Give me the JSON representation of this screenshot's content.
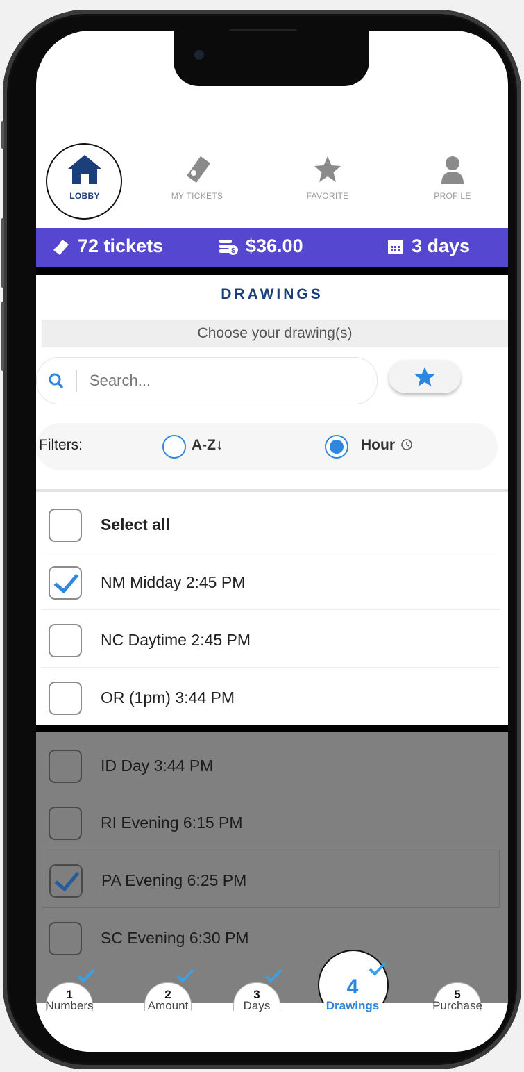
{
  "nav": {
    "items": [
      {
        "label": "LOBBY",
        "icon": "home-icon",
        "active": true
      },
      {
        "label": "MY TICKETS",
        "icon": "ticket-icon",
        "active": false
      },
      {
        "label": "FAVORITE",
        "icon": "star-icon",
        "active": false
      },
      {
        "label": "PROFILE",
        "icon": "user-icon",
        "active": false
      }
    ]
  },
  "stats": {
    "tickets": "72 tickets",
    "amount": "$36.00",
    "days": "3 days",
    "bar_color": "#5547cf"
  },
  "drawings": {
    "title": "DRAWINGS",
    "subtitle": "Choose your drawing(s)",
    "search_placeholder": "Search...",
    "filters_label": "Filters:",
    "filter_az": "A-Z↓",
    "filter_hour": "Hour",
    "selected_filter": "Hour"
  },
  "list": {
    "select_all": "Select all",
    "items": [
      {
        "label": "NM Midday 2:45 PM",
        "checked": true
      },
      {
        "label": "NC Daytime 2:45 PM",
        "checked": false
      },
      {
        "label": "OR (1pm) 3:44 PM",
        "checked": false
      }
    ],
    "overlay_items": [
      {
        "label": "ID Day 3:44 PM",
        "checked": false
      },
      {
        "label": "RI Evening 6:15 PM",
        "checked": false
      },
      {
        "label": "PA Evening 6:25 PM",
        "checked": true
      },
      {
        "label": "SC Evening 6:30 PM",
        "checked": false
      }
    ]
  },
  "stepper": {
    "steps": [
      {
        "num": "1",
        "label": "Numbers",
        "done": true
      },
      {
        "num": "2",
        "label": "Amount",
        "done": true
      },
      {
        "num": "3",
        "label": "Days",
        "done": true
      },
      {
        "num": "4",
        "label": "Drawings",
        "done": true,
        "active": true
      },
      {
        "num": "5",
        "label": "Purchase",
        "done": false
      }
    ]
  },
  "colors": {
    "accent": "#2e86de",
    "title_blue": "#1b3f7a"
  }
}
